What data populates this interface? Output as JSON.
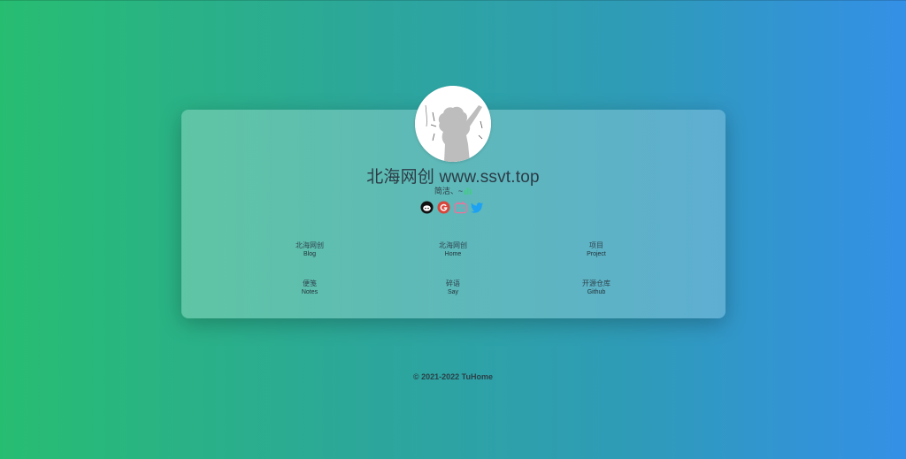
{
  "site": {
    "title": "北海网创 www.ssvt.top",
    "tagline": "简洁、~"
  },
  "avatar": {
    "alt": "avatar-illustration"
  },
  "social": [
    {
      "name": "github",
      "icon": "github-icon",
      "color": "#111111"
    },
    {
      "name": "google",
      "icon": "google-icon",
      "color": "#d8453b"
    },
    {
      "name": "bilibili",
      "icon": "bilibili-icon",
      "color": "#f0719c"
    },
    {
      "name": "twitter",
      "icon": "twitter-icon",
      "color": "#1da1f2"
    }
  ],
  "links": [
    {
      "cn": "北海网创",
      "en": "Blog"
    },
    {
      "cn": "北海网创",
      "en": "Home"
    },
    {
      "cn": "项目",
      "en": "Project"
    },
    {
      "cn": "便笺",
      "en": "Notes"
    },
    {
      "cn": "碎语",
      "en": "Say"
    },
    {
      "cn": "开源仓库",
      "en": "Github"
    }
  ],
  "footer": {
    "text": "© 2021-2022 TuHome"
  },
  "colors": {
    "gradient_start": "#27bd71",
    "gradient_end": "#3490e6",
    "card_overlay": "rgba(255,255,255,0.25)"
  }
}
